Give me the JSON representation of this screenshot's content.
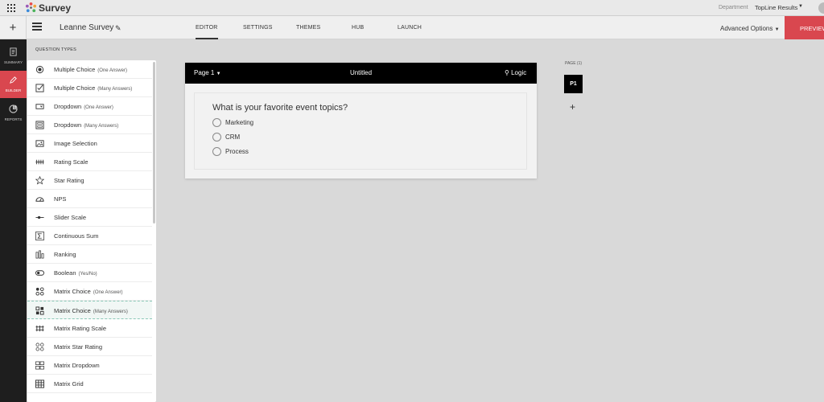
{
  "app": {
    "name": "Survey"
  },
  "header": {
    "department_label": "Department",
    "department_value": "TopLine Results"
  },
  "toolbar": {
    "survey_name": "Leanne Survey",
    "tabs": [
      "EDITOR",
      "SETTINGS",
      "THEMES",
      "HUB",
      "LAUNCH"
    ],
    "active_tab": "EDITOR",
    "advanced_options": "Advanced Options",
    "preview_label": "PREVIEW"
  },
  "sidebar": {
    "items": [
      {
        "label": "SUMMARY",
        "icon": "document-icon"
      },
      {
        "label": "BUILDER",
        "icon": "pencil-icon",
        "active": true
      },
      {
        "label": "REPORTS",
        "icon": "pie-chart-icon"
      }
    ]
  },
  "question_types": {
    "title": "QUESTION TYPES",
    "items": [
      {
        "label": "Multiple Choice",
        "sub": "(One Answer)",
        "icon": "radio-icon"
      },
      {
        "label": "Multiple Choice",
        "sub": "(Many Answers)",
        "icon": "checkbox-icon"
      },
      {
        "label": "Dropdown",
        "sub": "(One Answer)",
        "icon": "dropdown-icon"
      },
      {
        "label": "Dropdown",
        "sub": "(Many Answers)",
        "icon": "multi-dropdown-icon"
      },
      {
        "label": "Image Selection",
        "sub": "",
        "icon": "image-icon"
      },
      {
        "label": "Rating Scale",
        "sub": "",
        "icon": "rating-scale-icon"
      },
      {
        "label": "Star Rating",
        "sub": "",
        "icon": "star-icon"
      },
      {
        "label": "NPS",
        "sub": "",
        "icon": "gauge-icon"
      },
      {
        "label": "Slider Scale",
        "sub": "",
        "icon": "slider-icon"
      },
      {
        "label": "Continuous Sum",
        "sub": "",
        "icon": "sum-icon"
      },
      {
        "label": "Ranking",
        "sub": "",
        "icon": "ranking-icon"
      },
      {
        "label": "Boolean",
        "sub": "(Yes/No)",
        "icon": "toggle-icon"
      },
      {
        "label": "Matrix Choice",
        "sub": "(One Answer)",
        "icon": "matrix-radio-icon"
      },
      {
        "label": "Matrix Choice",
        "sub": "(Many Answers)",
        "icon": "matrix-checkbox-icon",
        "hover": true
      },
      {
        "label": "Matrix Rating Scale",
        "sub": "",
        "icon": "matrix-rating-icon"
      },
      {
        "label": "Matrix Star Rating",
        "sub": "",
        "icon": "matrix-star-icon"
      },
      {
        "label": "Matrix Dropdown",
        "sub": "",
        "icon": "matrix-dropdown-icon"
      },
      {
        "label": "Matrix Grid",
        "sub": "",
        "icon": "matrix-grid-icon"
      }
    ]
  },
  "page": {
    "selector": "Page 1",
    "title": "Untitled",
    "logic_label": "Logic",
    "question": "What is your favorite event topics?",
    "options": [
      "Marketing",
      "CRM",
      "Process"
    ]
  },
  "pages_nav": {
    "label": "PAGE (1)",
    "chip": "P1",
    "add": "+"
  }
}
